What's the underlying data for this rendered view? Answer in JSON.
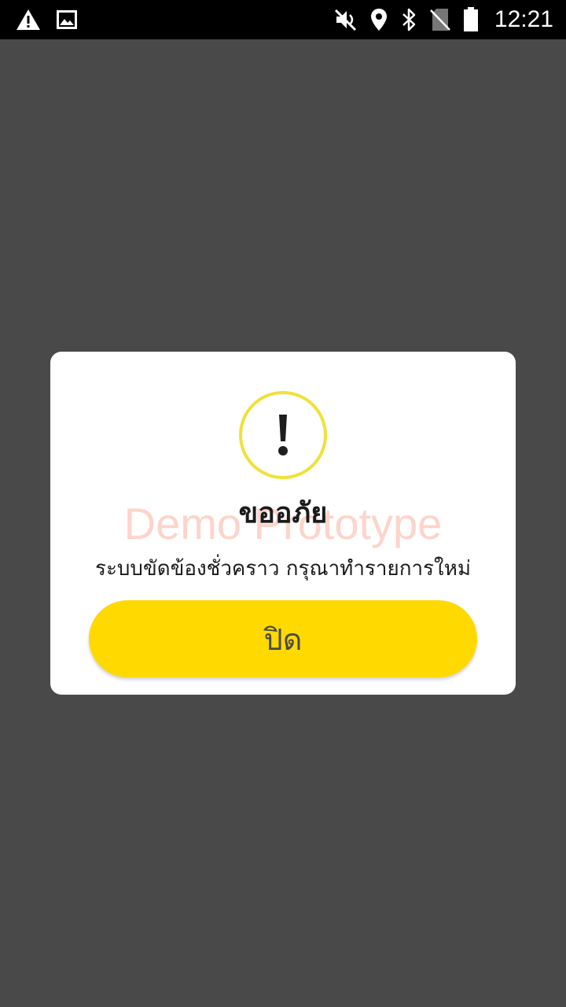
{
  "status_bar": {
    "time": "12:21",
    "icons": [
      "warning-icon",
      "image-icon",
      "mute-icon",
      "location-icon",
      "bluetooth-icon",
      "no-sim-icon",
      "battery-icon"
    ]
  },
  "dialog": {
    "icon": "exclamation-icon",
    "title": "ขออภัย",
    "watermark": "Demo Prototype",
    "message": "ระบบขัดข้องชั่วคราว กรุณาทำรายการใหม่",
    "close_label": "ปิด"
  },
  "colors": {
    "background": "#494949",
    "button": "#ffd900",
    "icon_ring": "#f2e03a",
    "watermark": "#faa08c"
  }
}
